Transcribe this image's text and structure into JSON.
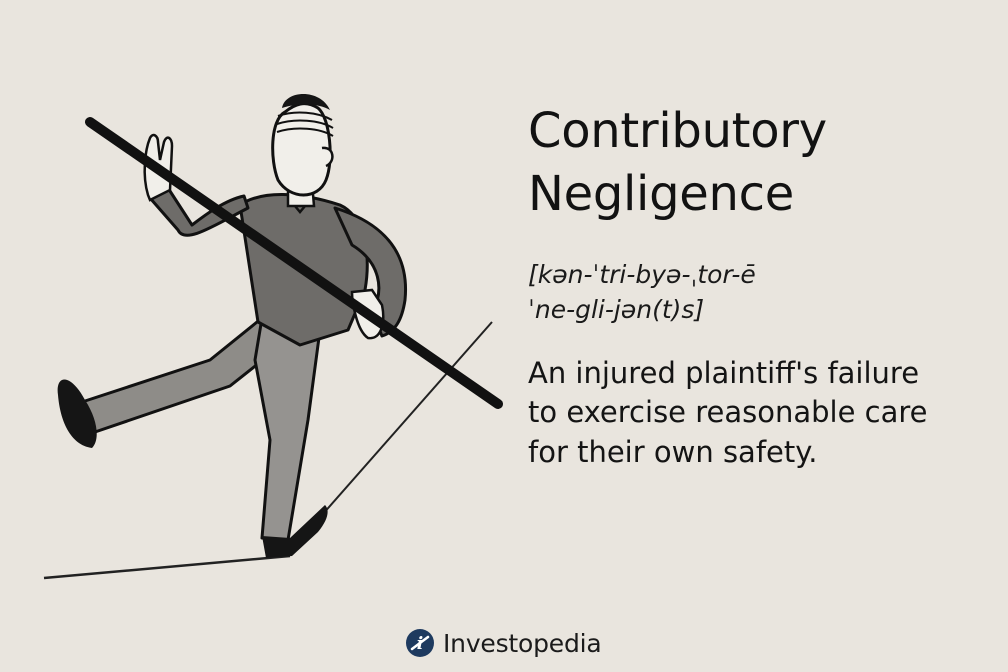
{
  "title_lines": [
    "Contributory",
    "Negligence"
  ],
  "pronunciation_lines": [
    "[kən-ˈtri-byə-ˌtor-ē",
    "ˈne-gli-jən(t)s]"
  ],
  "definition_lines": [
    "An injured plaintiff's failure",
    "to exercise reasonable care",
    "for their own safety."
  ],
  "brand": {
    "name": "Investopedia",
    "logo_letter": "i"
  },
  "colors": {
    "background": "#e9e5de",
    "ink": "#111111",
    "brand_navy": "#1e3a5f"
  }
}
